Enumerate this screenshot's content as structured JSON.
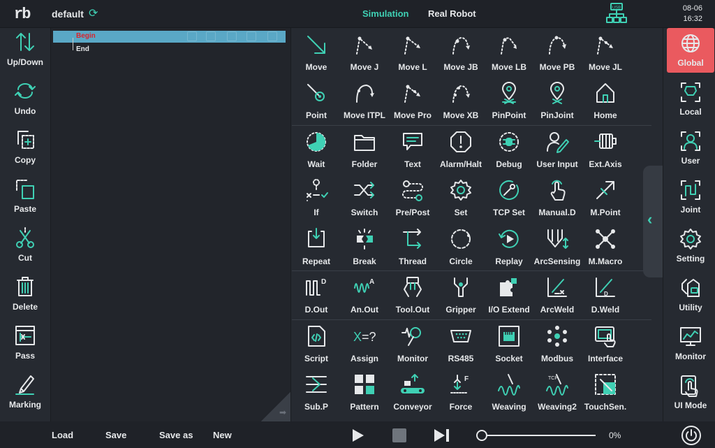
{
  "header": {
    "logo": "rb",
    "program_name": "default",
    "modes": [
      "Simulation",
      "Real Robot"
    ],
    "usb_label": "USB",
    "date": "08-06",
    "time": "16:32"
  },
  "left_tools": [
    "Up/Down",
    "Undo",
    "Copy",
    "Paste",
    "Cut",
    "Delete",
    "Pass",
    "Marking"
  ],
  "tree": {
    "nodes": [
      "Begin",
      "End"
    ]
  },
  "commands": [
    [
      "Move",
      "Move J",
      "Move L",
      "Move JB",
      "Move LB",
      "Move PB",
      "Move JL"
    ],
    [
      "Point",
      "Move ITPL",
      "Move Pro",
      "Move XB",
      "PinPoint",
      "PinJoint",
      "Home"
    ],
    [
      "Wait",
      "Folder",
      "Text",
      "Alarm/Halt",
      "Debug",
      "User Input",
      "Ext.Axis"
    ],
    [
      "If",
      "Switch",
      "Pre/Post",
      "Set",
      "TCP Set",
      "Manual.D",
      "M.Point"
    ],
    [
      "Repeat",
      "Break",
      "Thread",
      "Circle",
      "Replay",
      "ArcSensing",
      "M.Macro"
    ],
    [
      "D.Out",
      "An.Out",
      "Tool.Out",
      "Gripper",
      "I/O Extend",
      "ArcWeld",
      "D.Weld"
    ],
    [
      "Script",
      "Assign",
      "Monitor",
      "RS485",
      "Socket",
      "Modbus",
      "Interface"
    ],
    [
      "Sub.P",
      "Pattern",
      "Conveyor",
      "Force",
      "Weaving",
      "Weaving2",
      "TouchSen."
    ]
  ],
  "right_tools": [
    "Global",
    "Local",
    "User",
    "Joint",
    "Setting",
    "Utility",
    "Monitor",
    "UI Mode"
  ],
  "active_right_tool": "Global",
  "footer": {
    "buttons": [
      "Load",
      "Save",
      "Save as",
      "New"
    ],
    "speed_percent": "0%"
  },
  "colors": {
    "accent": "#3fd0b4",
    "active": "#ea5a5f",
    "begin": "#d9232d",
    "selection": "#5aa8c6"
  }
}
